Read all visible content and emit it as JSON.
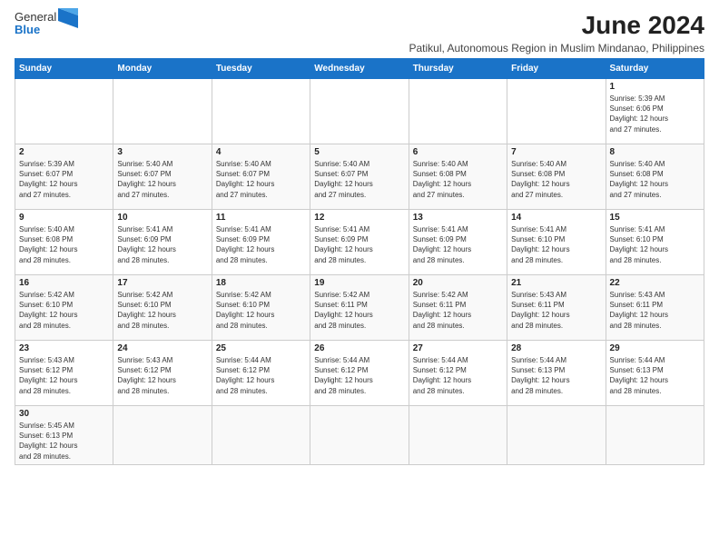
{
  "logo": {
    "text_general": "General",
    "text_blue": "Blue"
  },
  "title": "June 2024",
  "subtitle": "Patikul, Autonomous Region in Muslim Mindanao, Philippines",
  "header_color": "#1a73c8",
  "days_of_week": [
    "Sunday",
    "Monday",
    "Tuesday",
    "Wednesday",
    "Thursday",
    "Friday",
    "Saturday"
  ],
  "weeks": [
    [
      {
        "day": "",
        "info": ""
      },
      {
        "day": "",
        "info": ""
      },
      {
        "day": "",
        "info": ""
      },
      {
        "day": "",
        "info": ""
      },
      {
        "day": "",
        "info": ""
      },
      {
        "day": "",
        "info": ""
      },
      {
        "day": "1",
        "info": "Sunrise: 5:39 AM\nSunset: 6:06 PM\nDaylight: 12 hours\nand 27 minutes."
      }
    ],
    [
      {
        "day": "2",
        "info": "Sunrise: 5:39 AM\nSunset: 6:07 PM\nDaylight: 12 hours\nand 27 minutes."
      },
      {
        "day": "3",
        "info": "Sunrise: 5:40 AM\nSunset: 6:07 PM\nDaylight: 12 hours\nand 27 minutes."
      },
      {
        "day": "4",
        "info": "Sunrise: 5:40 AM\nSunset: 6:07 PM\nDaylight: 12 hours\nand 27 minutes."
      },
      {
        "day": "5",
        "info": "Sunrise: 5:40 AM\nSunset: 6:07 PM\nDaylight: 12 hours\nand 27 minutes."
      },
      {
        "day": "6",
        "info": "Sunrise: 5:40 AM\nSunset: 6:08 PM\nDaylight: 12 hours\nand 27 minutes."
      },
      {
        "day": "7",
        "info": "Sunrise: 5:40 AM\nSunset: 6:08 PM\nDaylight: 12 hours\nand 27 minutes."
      },
      {
        "day": "8",
        "info": "Sunrise: 5:40 AM\nSunset: 6:08 PM\nDaylight: 12 hours\nand 27 minutes."
      }
    ],
    [
      {
        "day": "9",
        "info": "Sunrise: 5:40 AM\nSunset: 6:08 PM\nDaylight: 12 hours\nand 28 minutes."
      },
      {
        "day": "10",
        "info": "Sunrise: 5:41 AM\nSunset: 6:09 PM\nDaylight: 12 hours\nand 28 minutes."
      },
      {
        "day": "11",
        "info": "Sunrise: 5:41 AM\nSunset: 6:09 PM\nDaylight: 12 hours\nand 28 minutes."
      },
      {
        "day": "12",
        "info": "Sunrise: 5:41 AM\nSunset: 6:09 PM\nDaylight: 12 hours\nand 28 minutes."
      },
      {
        "day": "13",
        "info": "Sunrise: 5:41 AM\nSunset: 6:09 PM\nDaylight: 12 hours\nand 28 minutes."
      },
      {
        "day": "14",
        "info": "Sunrise: 5:41 AM\nSunset: 6:10 PM\nDaylight: 12 hours\nand 28 minutes."
      },
      {
        "day": "15",
        "info": "Sunrise: 5:41 AM\nSunset: 6:10 PM\nDaylight: 12 hours\nand 28 minutes."
      }
    ],
    [
      {
        "day": "16",
        "info": "Sunrise: 5:42 AM\nSunset: 6:10 PM\nDaylight: 12 hours\nand 28 minutes."
      },
      {
        "day": "17",
        "info": "Sunrise: 5:42 AM\nSunset: 6:10 PM\nDaylight: 12 hours\nand 28 minutes."
      },
      {
        "day": "18",
        "info": "Sunrise: 5:42 AM\nSunset: 6:10 PM\nDaylight: 12 hours\nand 28 minutes."
      },
      {
        "day": "19",
        "info": "Sunrise: 5:42 AM\nSunset: 6:11 PM\nDaylight: 12 hours\nand 28 minutes."
      },
      {
        "day": "20",
        "info": "Sunrise: 5:42 AM\nSunset: 6:11 PM\nDaylight: 12 hours\nand 28 minutes."
      },
      {
        "day": "21",
        "info": "Sunrise: 5:43 AM\nSunset: 6:11 PM\nDaylight: 12 hours\nand 28 minutes."
      },
      {
        "day": "22",
        "info": "Sunrise: 5:43 AM\nSunset: 6:11 PM\nDaylight: 12 hours\nand 28 minutes."
      }
    ],
    [
      {
        "day": "23",
        "info": "Sunrise: 5:43 AM\nSunset: 6:12 PM\nDaylight: 12 hours\nand 28 minutes."
      },
      {
        "day": "24",
        "info": "Sunrise: 5:43 AM\nSunset: 6:12 PM\nDaylight: 12 hours\nand 28 minutes."
      },
      {
        "day": "25",
        "info": "Sunrise: 5:44 AM\nSunset: 6:12 PM\nDaylight: 12 hours\nand 28 minutes."
      },
      {
        "day": "26",
        "info": "Sunrise: 5:44 AM\nSunset: 6:12 PM\nDaylight: 12 hours\nand 28 minutes."
      },
      {
        "day": "27",
        "info": "Sunrise: 5:44 AM\nSunset: 6:12 PM\nDaylight: 12 hours\nand 28 minutes."
      },
      {
        "day": "28",
        "info": "Sunrise: 5:44 AM\nSunset: 6:13 PM\nDaylight: 12 hours\nand 28 minutes."
      },
      {
        "day": "29",
        "info": "Sunrise: 5:44 AM\nSunset: 6:13 PM\nDaylight: 12 hours\nand 28 minutes."
      }
    ],
    [
      {
        "day": "30",
        "info": "Sunrise: 5:45 AM\nSunset: 6:13 PM\nDaylight: 12 hours\nand 28 minutes."
      },
      {
        "day": "",
        "info": ""
      },
      {
        "day": "",
        "info": ""
      },
      {
        "day": "",
        "info": ""
      },
      {
        "day": "",
        "info": ""
      },
      {
        "day": "",
        "info": ""
      },
      {
        "day": "",
        "info": ""
      }
    ]
  ]
}
